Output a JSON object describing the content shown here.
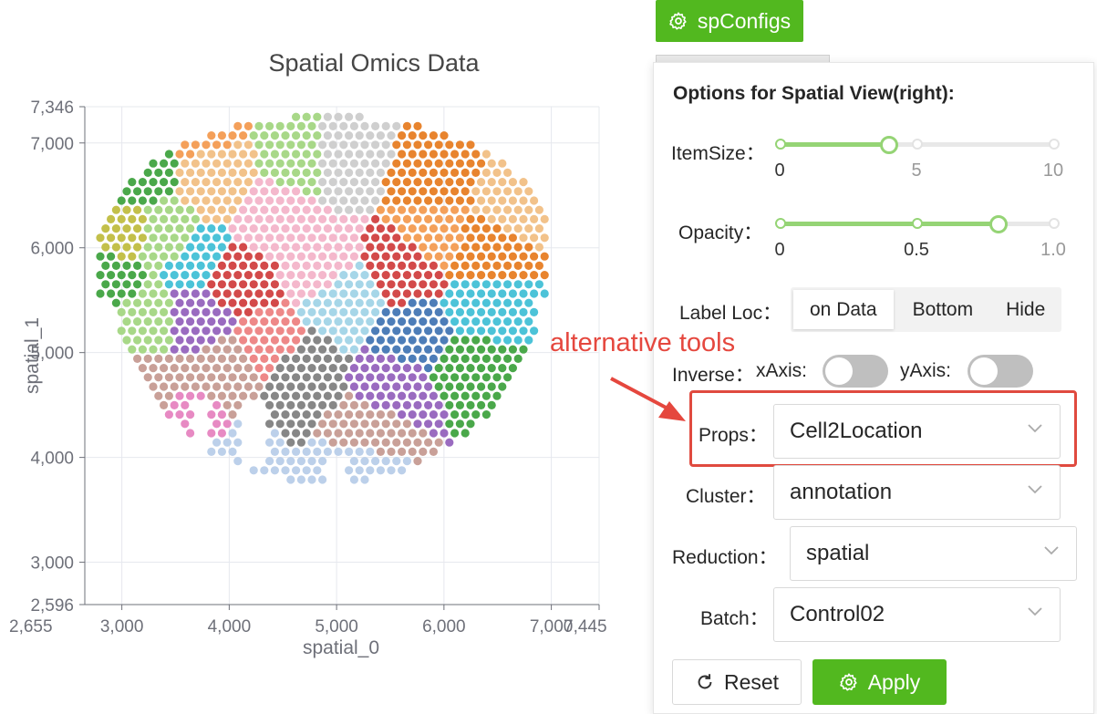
{
  "chart_data": {
    "type": "scatter",
    "title": "Spatial Omics Data",
    "xlabel": "spatial_0",
    "ylabel": "spatial_1",
    "xlim": [
      2655,
      7445
    ],
    "ylim": [
      2596,
      7346
    ],
    "x_ticks": [
      "3,000",
      "4,000",
      "5,000",
      "6,000",
      "7,000"
    ],
    "y_ticks": [
      "7,346",
      "7,000",
      "6,000",
      "5,000",
      "4,000",
      "3,000",
      "2,596"
    ],
    "x_edge_labels": [
      "2,655",
      "7,445"
    ],
    "grid": true,
    "point_shape": "hexagonal-grid spots colored by annotation cluster",
    "cluster_colors": [
      "#4aa84a",
      "#c3c04a",
      "#f4a05a",
      "#f2c28a",
      "#a8d888",
      "#e8842e",
      "#f4b8cc",
      "#d34a4a",
      "#4cc3d8",
      "#a6d6e8",
      "#4d7db8",
      "#9a6bc0",
      "#878787",
      "#c9a098",
      "#e78ac3",
      "#bcd0ea",
      "#ee8888",
      "#cfcfcf"
    ]
  },
  "toolbar": {
    "spconfigs_label": "spConfigs"
  },
  "panel": {
    "title": "Options for Spatial View(right):",
    "item_size": {
      "label": "ItemSize",
      "min": 0,
      "max": 10,
      "value": 4,
      "marks": [
        "0",
        "5",
        "10"
      ]
    },
    "opacity": {
      "label": "Opacity",
      "min": 0,
      "max": 1,
      "value": 0.8,
      "marks": [
        "0",
        "0.5",
        "1.0"
      ]
    },
    "label_loc": {
      "label": "Label Loc",
      "options": [
        "on Data",
        "Bottom",
        "Hide"
      ],
      "selected": "on Data"
    },
    "inverse": {
      "label": "Inverse",
      "x_label": "xAxis:",
      "y_label": "yAxis:",
      "x_on": false,
      "y_on": false
    },
    "props": {
      "label": "Props",
      "value": "Cell2Location"
    },
    "cluster": {
      "label": "Cluster",
      "value": "annotation"
    },
    "reduction": {
      "label": "Reduction",
      "value": "spatial"
    },
    "batch": {
      "label": "Batch",
      "value": "Control02"
    },
    "reset_label": "Reset",
    "apply_label": "Apply"
  },
  "annotation": {
    "text": "alternative tools",
    "color": "#e5473e"
  },
  "colors": {
    "accent": "#52b81f",
    "slider": "#95d475"
  }
}
